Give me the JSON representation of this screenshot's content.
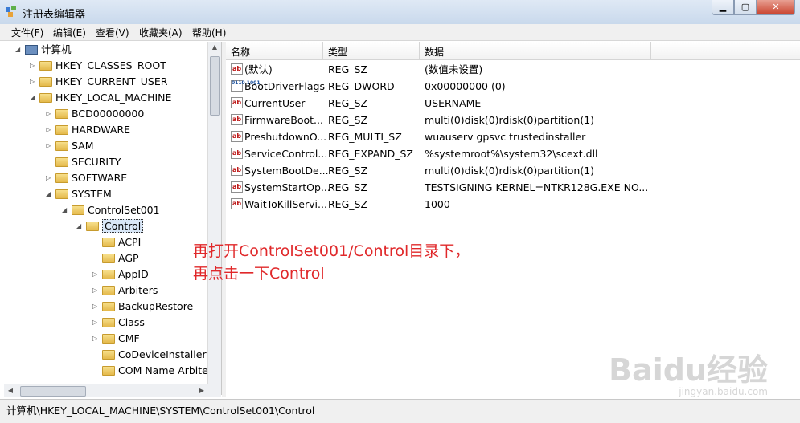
{
  "window": {
    "title": "注册表编辑器"
  },
  "menu": [
    "文件(F)",
    "编辑(E)",
    "查看(V)",
    "收藏夹(A)",
    "帮助(H)"
  ],
  "tree": [
    {
      "label": "计算机",
      "level": 0,
      "twisty": "◢",
      "icon": "computer"
    },
    {
      "label": "HKEY_CLASSES_ROOT",
      "level": 1,
      "twisty": "▷",
      "icon": "folder"
    },
    {
      "label": "HKEY_CURRENT_USER",
      "level": 1,
      "twisty": "▷",
      "icon": "folder"
    },
    {
      "label": "HKEY_LOCAL_MACHINE",
      "level": 1,
      "twisty": "◢",
      "icon": "folder"
    },
    {
      "label": "BCD00000000",
      "level": 2,
      "twisty": "▷",
      "icon": "folder"
    },
    {
      "label": "HARDWARE",
      "level": 2,
      "twisty": "▷",
      "icon": "folder"
    },
    {
      "label": "SAM",
      "level": 2,
      "twisty": "▷",
      "icon": "folder"
    },
    {
      "label": "SECURITY",
      "level": 2,
      "twisty": "",
      "icon": "folder"
    },
    {
      "label": "SOFTWARE",
      "level": 2,
      "twisty": "▷",
      "icon": "folder"
    },
    {
      "label": "SYSTEM",
      "level": 2,
      "twisty": "◢",
      "icon": "folder"
    },
    {
      "label": "ControlSet001",
      "level": 3,
      "twisty": "◢",
      "icon": "folder"
    },
    {
      "label": "Control",
      "level": 4,
      "twisty": "◢",
      "icon": "folder",
      "selected": true
    },
    {
      "label": "ACPI",
      "level": 5,
      "twisty": "",
      "icon": "folder"
    },
    {
      "label": "AGP",
      "level": 5,
      "twisty": "",
      "icon": "folder"
    },
    {
      "label": "AppID",
      "level": 5,
      "twisty": "▷",
      "icon": "folder"
    },
    {
      "label": "Arbiters",
      "level": 5,
      "twisty": "▷",
      "icon": "folder"
    },
    {
      "label": "BackupRestore",
      "level": 5,
      "twisty": "▷",
      "icon": "folder"
    },
    {
      "label": "Class",
      "level": 5,
      "twisty": "▷",
      "icon": "folder"
    },
    {
      "label": "CMF",
      "level": 5,
      "twisty": "▷",
      "icon": "folder"
    },
    {
      "label": "CoDeviceInstallers",
      "level": 5,
      "twisty": "",
      "icon": "folder"
    },
    {
      "label": "COM Name Arbiter",
      "level": 5,
      "twisty": "",
      "icon": "folder"
    }
  ],
  "list": {
    "headers": [
      "名称",
      "类型",
      "数据"
    ],
    "rows": [
      {
        "name": "(默认)",
        "type": "REG_SZ",
        "data": "(数值未设置)",
        "icon": "ab"
      },
      {
        "name": "BootDriverFlags",
        "type": "REG_DWORD",
        "data": "0x00000000 (0)",
        "icon": "bin"
      },
      {
        "name": "CurrentUser",
        "type": "REG_SZ",
        "data": "USERNAME",
        "icon": "ab"
      },
      {
        "name": "FirmwareBoot...",
        "type": "REG_SZ",
        "data": "multi(0)disk(0)rdisk(0)partition(1)",
        "icon": "ab"
      },
      {
        "name": "PreshutdownO...",
        "type": "REG_MULTI_SZ",
        "data": "wuauserv gpsvc trustedinstaller",
        "icon": "ab"
      },
      {
        "name": "ServiceControl...",
        "type": "REG_EXPAND_SZ",
        "data": "%systemroot%\\system32\\scext.dll",
        "icon": "ab"
      },
      {
        "name": "SystemBootDe...",
        "type": "REG_SZ",
        "data": "multi(0)disk(0)rdisk(0)partition(1)",
        "icon": "ab"
      },
      {
        "name": "SystemStartOp...",
        "type": "REG_SZ",
        "data": " TESTSIGNING  KERNEL=NTKR128G.EXE  NO...",
        "icon": "ab"
      },
      {
        "name": "WaitToKillServi...",
        "type": "REG_SZ",
        "data": "1000",
        "icon": "ab"
      }
    ]
  },
  "annotation": [
    "再打开ControlSet001/Control目录下，",
    "再点击一下Control"
  ],
  "status": "计算机\\HKEY_LOCAL_MACHINE\\SYSTEM\\ControlSet001\\Control",
  "watermark": {
    "brand": "Baidu经验",
    "url": "jingyan.baidu.com"
  }
}
